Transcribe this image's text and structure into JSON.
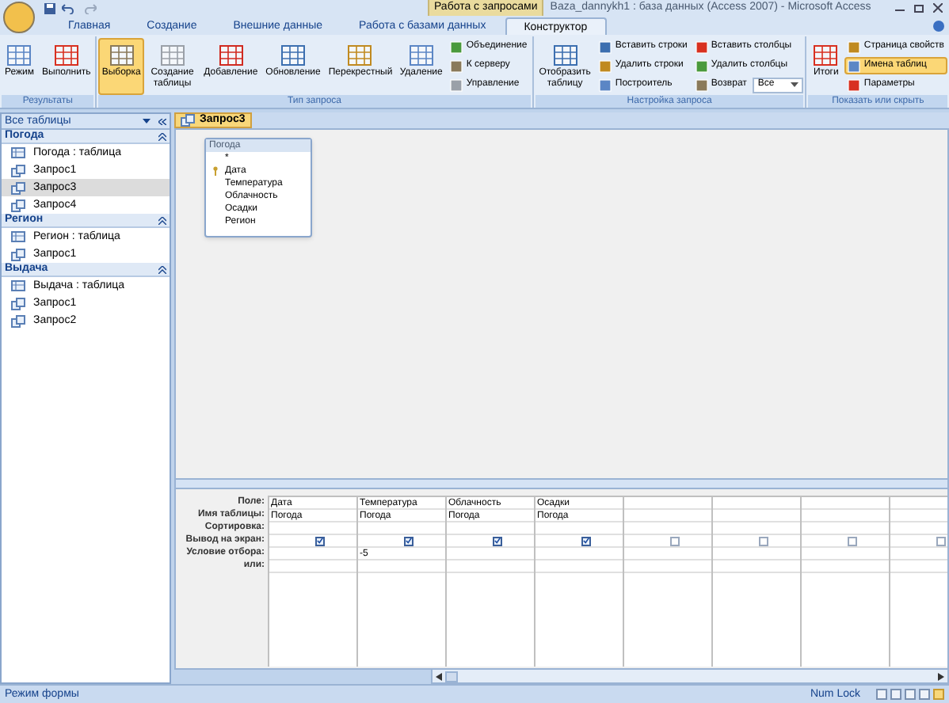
{
  "window": {
    "title": "Baza_dannykh1 : база данных (Access 2007) - Microsoft Access",
    "contextual_tab": "Работа с запросами"
  },
  "ribbon_tabs": [
    {
      "label": "Главная",
      "selected": false
    },
    {
      "label": "Создание",
      "selected": false
    },
    {
      "label": "Внешние данные",
      "selected": false
    },
    {
      "label": "Работа с базами данных",
      "selected": false
    },
    {
      "label": "Конструктор",
      "selected": true
    }
  ],
  "ribbon_groups": [
    {
      "label": "Результаты",
      "buttons": [
        {
          "label": "Режим",
          "kind": "large",
          "selected": false
        },
        {
          "label": "Выполнить",
          "kind": "large",
          "selected": false
        }
      ]
    },
    {
      "label": "Тип запроса",
      "buttons": [
        {
          "label": "Выборка",
          "kind": "large",
          "selected": true
        },
        {
          "label": "Создание таблицы",
          "kind": "large",
          "selected": false
        },
        {
          "label": "Добавление",
          "kind": "large",
          "selected": false
        },
        {
          "label": "Обновление",
          "kind": "large",
          "selected": false
        },
        {
          "label": "Перекрестный",
          "kind": "large",
          "selected": false
        },
        {
          "label": "Удаление",
          "kind": "large",
          "selected": false
        },
        {
          "label": "Объединение",
          "kind": "small",
          "selected": false
        },
        {
          "label": "К серверу",
          "kind": "small",
          "selected": false
        },
        {
          "label": "Управление",
          "kind": "small",
          "selected": false
        }
      ]
    },
    {
      "label": "Настройка запроса",
      "buttons": [
        {
          "label": "Отобразить таблицу",
          "kind": "large",
          "selected": false
        },
        {
          "label": "Вставить строки",
          "kind": "small",
          "selected": false
        },
        {
          "label": "Удалить строки",
          "kind": "small",
          "selected": false
        },
        {
          "label": "Построитель",
          "kind": "small",
          "selected": false
        },
        {
          "label": "Вставить столбцы",
          "kind": "small",
          "selected": false
        },
        {
          "label": "Удалить столбцы",
          "kind": "small",
          "selected": false
        },
        {
          "label": "Возврат",
          "kind": "combo",
          "selected": false,
          "value": "Все"
        }
      ]
    },
    {
      "label": "Показать или скрыть",
      "buttons": [
        {
          "label": "Итоги",
          "kind": "large",
          "selected": false
        },
        {
          "label": "Страница свойств",
          "kind": "small",
          "selected": false
        },
        {
          "label": "Имена таблиц",
          "kind": "small",
          "selected": true
        },
        {
          "label": "Параметры",
          "kind": "small",
          "selected": false
        }
      ]
    }
  ],
  "nav": {
    "header": "Все таблицы",
    "groups": [
      {
        "title": "Погода",
        "items": [
          {
            "label": "Погода : таблица",
            "kind": "table",
            "selected": false
          },
          {
            "label": "Запрос1",
            "kind": "query",
            "selected": false
          },
          {
            "label": "Запрос3",
            "kind": "query",
            "selected": true
          },
          {
            "label": "Запрос4",
            "kind": "query",
            "selected": false
          }
        ]
      },
      {
        "title": "Регион",
        "items": [
          {
            "label": "Регион : таблица",
            "kind": "table",
            "selected": false
          },
          {
            "label": "Запрос1",
            "kind": "query",
            "selected": false
          }
        ]
      },
      {
        "title": "Выдача",
        "items": [
          {
            "label": "Выдача : таблица",
            "kind": "table",
            "selected": false
          },
          {
            "label": "Запрос1",
            "kind": "query",
            "selected": false
          },
          {
            "label": "Запрос2",
            "kind": "query",
            "selected": false
          }
        ]
      }
    ]
  },
  "document_tab": {
    "label": "Запрос3"
  },
  "table_box": {
    "title": "Погода",
    "fields": [
      {
        "label": "*",
        "primary_key": false
      },
      {
        "label": "Дата",
        "primary_key": true
      },
      {
        "label": "Температура",
        "primary_key": false
      },
      {
        "label": "Облачность",
        "primary_key": false
      },
      {
        "label": "Осадки",
        "primary_key": false
      },
      {
        "label": "Регион",
        "primary_key": false
      }
    ]
  },
  "grid": {
    "row_labels": [
      "Поле:",
      "Имя таблицы:",
      "Сортировка:",
      "Вывод на экран:",
      "Условие отбора:",
      "или:"
    ],
    "columns": [
      {
        "field": "Дата",
        "table": "Погода",
        "show": true
      },
      {
        "field": "Температура",
        "table": "Погода",
        "show": true,
        "criteria": "-5"
      },
      {
        "field": "Облачность",
        "table": "Погода",
        "show": true
      },
      {
        "field": "Осадки",
        "table": "Погода",
        "show": true
      },
      {
        "show": false
      },
      {
        "show": false
      },
      {
        "show": false
      },
      {
        "show": false
      }
    ]
  },
  "status_bar": {
    "left": "Режим формы",
    "right": "Num Lock"
  }
}
